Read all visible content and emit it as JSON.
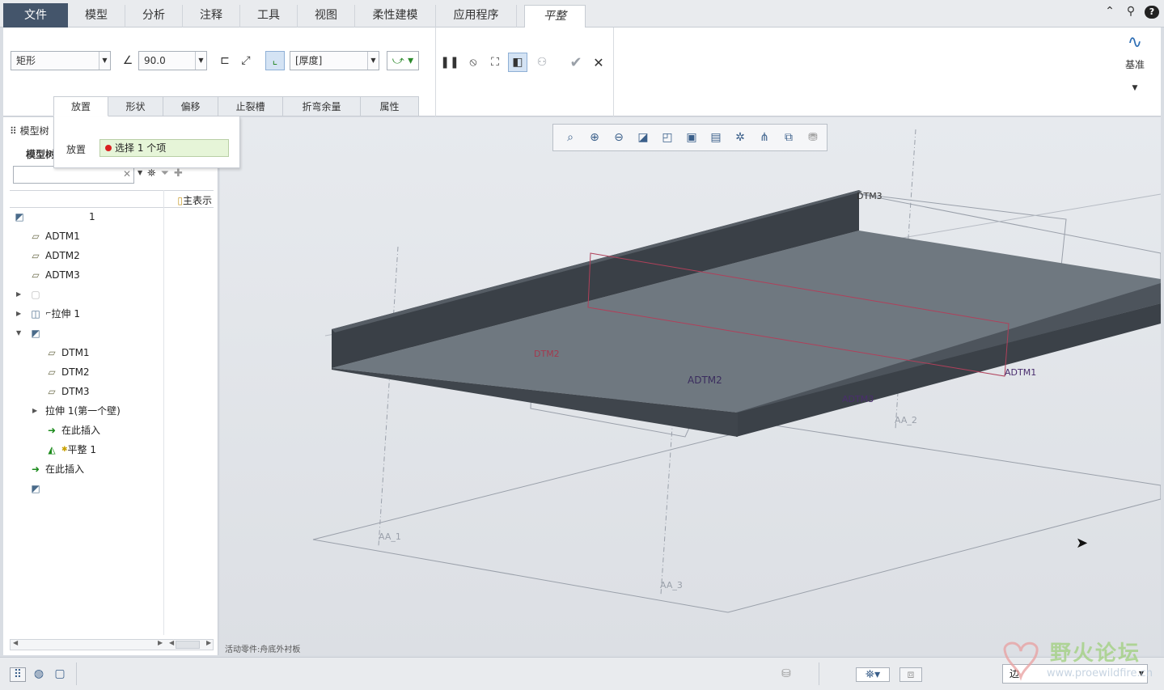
{
  "menu": {
    "file": "文件",
    "tabs": [
      "模型",
      "分析",
      "注释",
      "工具",
      "视图",
      "柔性建模",
      "应用程序"
    ],
    "active": "平整"
  },
  "ribbon": {
    "shape_value": "矩形",
    "angle_value": "90.0",
    "thickness_value": "[厚度]",
    "base_label": "基准"
  },
  "subtabs": [
    "放置",
    "形状",
    "偏移",
    "止裂槽",
    "折弯余量",
    "属性"
  ],
  "placement_panel": {
    "label": "放置",
    "collector_text": "选择 1 个项"
  },
  "left_panel": {
    "header": "模型树",
    "header2": "模型树",
    "column_header": "主表示",
    "search_placeholder": ""
  },
  "tree": [
    {
      "label": "1",
      "icon": "part-icon",
      "level": 0
    },
    {
      "label": "ADTM1",
      "icon": "datum-plane-icon",
      "level": 1
    },
    {
      "label": "ADTM2",
      "icon": "datum-plane-icon",
      "level": 1
    },
    {
      "label": "ADTM3",
      "icon": "datum-plane-icon",
      "level": 1
    },
    {
      "label": "",
      "icon": "component-icon",
      "level": 1,
      "expander": "▶"
    },
    {
      "label": "拉伸 1",
      "icon": "extrude-icon",
      "level": 1,
      "expander": "▶"
    },
    {
      "label": "",
      "icon": "sheetmetal-part-icon",
      "level": 1,
      "expander": "▼"
    },
    {
      "label": "DTM1",
      "icon": "datum-plane-icon",
      "level": 2
    },
    {
      "label": "DTM2",
      "icon": "datum-plane-icon",
      "level": 2
    },
    {
      "label": "DTM3",
      "icon": "datum-plane-icon",
      "level": 2
    },
    {
      "label": "拉伸 1(第一个壁)",
      "icon": "extrude-icon",
      "level": 2,
      "expander": "▶"
    },
    {
      "label": "在此插入",
      "icon": "insert-here-icon",
      "level": 2
    },
    {
      "label": "平整 1",
      "icon": "flat-wall-icon",
      "level": 2
    },
    {
      "label": "在此插入",
      "icon": "insert-here-icon",
      "level": 1
    },
    {
      "label": "",
      "icon": "part-icon",
      "level": 1
    }
  ],
  "graphics": {
    "datum_labels": [
      "DTM3",
      "DTM2",
      "ADTM2",
      "ADTM3",
      "ADTM1",
      "AA_2",
      "AA_1",
      "AA_3"
    ],
    "status_message": "活动零件:舟底外衬板"
  },
  "statusbar": {
    "filter_value": "边"
  },
  "watermark": {
    "title": "野火论坛",
    "url": "www.proewildfire.cn"
  },
  "colors": {
    "file_tab": "#44556b",
    "collector_bg": "#e6f5d8",
    "model_face": "#6f7880",
    "model_wall": "#3a4047"
  }
}
